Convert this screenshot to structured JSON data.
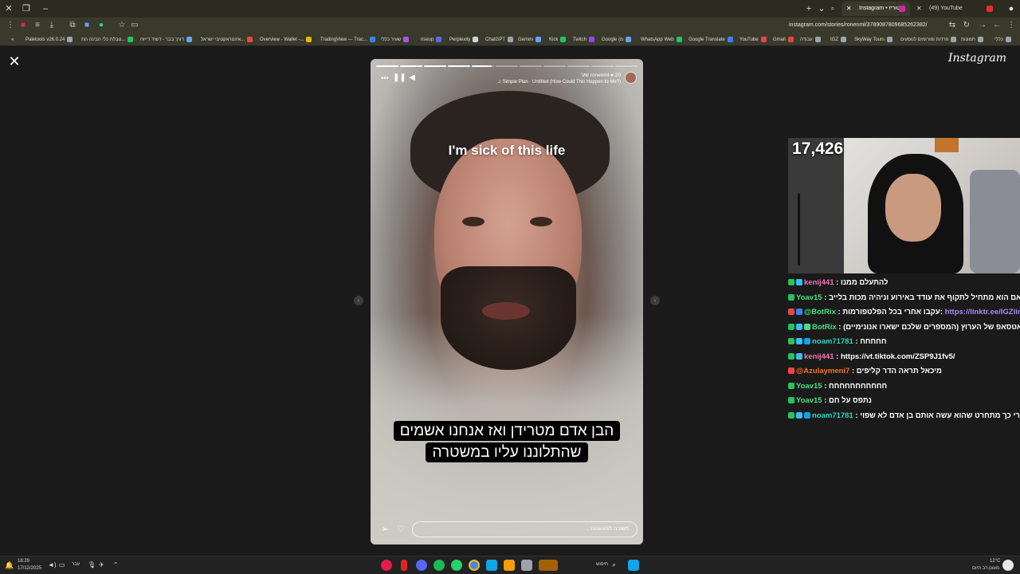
{
  "browser": {
    "tabs": [
      {
        "label": "Instagram • סטוריז",
        "active": true
      },
      {
        "label": "(49) YouTube",
        "active": false
      }
    ],
    "url": "instagram.com/stories/ronenml/3789087809685262382/",
    "bookmarks": [
      "Paletools v26.0.24",
      "טבלת כלי הבינה הת...",
      "דורך בבר - דשיד דייזה",
      "אינטראקטיבי ישראל...",
      "Overview - Wallet -...",
      "TradingView — Trac...",
      "שעיר כללי",
      "riseup",
      "Perplexity",
      "ChatGPT",
      "Gemini",
      "Kick",
      "Twitch",
      "Google (מ",
      "WhatsApp Web",
      "Google Translate",
      "YouTube",
      "Gmail",
      "עבודה",
      "IGZ",
      "SkyWay Tours",
      "פרדות ופורומים לנוסעים",
      "תמונות",
      "כללי"
    ]
  },
  "story": {
    "username": "ronenml",
    "time_ago": "20 שע'",
    "song": "Simple Plan · Untitled (How Could This Happen to Me?)",
    "segments": [
      1,
      1,
      1,
      1,
      0.9,
      0,
      0,
      0,
      0,
      0,
      0
    ],
    "caption_top": "I'm sick of this life",
    "caption_bottom_line1": "הבן אדם מטרידן ואז אנחנו אשמים",
    "caption_bottom_line2": "שהתלוננו עליו במשטרה",
    "reply_placeholder": "תשובה לronenml..."
  },
  "viewer": {
    "logo": "Instagram"
  },
  "stream": {
    "viewer_count": "17,426",
    "chat": [
      {
        "user": "kenij441",
        "user_color": "#f472b6",
        "badges": [
          "#22c55e",
          "#38bdf8"
        ],
        "msg": "להתעלם ממנו"
      },
      {
        "user": "Yoav15",
        "user_color": "#4ade80",
        "badges": [
          "#22c55e"
        ],
        "msg": "אם הוא מתחיל לתקוף את עודד באירוע וניהיה מכות בלייב"
      },
      {
        "user": "@BotRix",
        "user_color": "#4ade80",
        "badges": [
          "#ef4444",
          "#3b82f6"
        ],
        "msg": "עקבו אחרי בכל הפלטפורמות:",
        "link": "https://linktr.ee/IGZlin"
      },
      {
        "user": "BotRix",
        "user_color": "#4ade80",
        "badges": [
          "#22c55e",
          "#38bdf8",
          "#4ade80"
        ],
        "msg": "הוואטסאפ של הערוץ (המספרים שלכם ישארו אנונימיים)"
      },
      {
        "user": "noam71781",
        "user_color": "#2dd4bf",
        "badges": [
          "#22c55e",
          "#38bdf8",
          "#0ea5e9"
        ],
        "msg": "חחחחח"
      },
      {
        "user": "kenij441",
        "user_color": "#f472b6",
        "badges": [
          "#22c55e",
          "#38bdf8"
        ],
        "msg": "https://vt.tiktok.com/ZSP9J1fv5/"
      },
      {
        "user": "@Azulaymeni7",
        "user_color": "#f97316",
        "badges": [
          "#ef4444"
        ],
        "msg": "מיכאל תראה הדר קליפים"
      },
      {
        "user": "Yoav15",
        "user_color": "#4ade80",
        "badges": [
          "#22c55e"
        ],
        "msg": "חחחחחחחחחחח"
      },
      {
        "user": "Yoav15",
        "user_color": "#4ade80",
        "badges": [
          "#22c55e"
        ],
        "msg": "נתפס על חם"
      },
      {
        "user": "noam71781",
        "user_color": "#2dd4bf",
        "badges": [
          "#22c55e",
          "#38bdf8",
          "#0ea5e9"
        ],
        "msg": "אחרי כך מתחרט שהוא עשה אותם בן אדם לא שפוי"
      }
    ]
  },
  "taskbar": {
    "time": "18:29",
    "date": "17/12/2025",
    "lang": "עבר",
    "search_label": "חיפוש",
    "weather_temp": "12°C",
    "weather_desc": "מעונן רב היום"
  }
}
